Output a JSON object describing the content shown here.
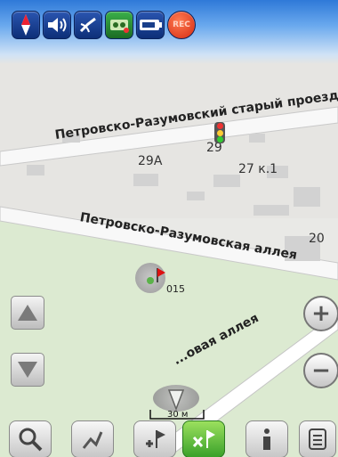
{
  "statusbar": {
    "icons": [
      "compass-icon",
      "speaker-icon",
      "satellite-icon",
      "tracker-icon",
      "battery-icon",
      "record-icon"
    ],
    "record_label": "REC"
  },
  "map": {
    "streets": {
      "top": "Петровско-Разумовский старый проезд",
      "middle": "Петровско-Разумовская аллея",
      "lower": "...овая аллея"
    },
    "houses": {
      "h29a": "29А",
      "h29": "29",
      "h27k1": "27 к.1",
      "h20": "20"
    },
    "poi": {
      "label": "015"
    },
    "scale": "30 м"
  },
  "controls": {
    "zoom_in": "+",
    "zoom_out": "−",
    "nav_up": "▲",
    "nav_down": "▼"
  },
  "toolbar": {
    "items": [
      {
        "icon": "search-icon"
      },
      {
        "icon": "route-icon"
      },
      {
        "icon": "add-waypoint-icon"
      },
      {
        "icon": "clear-route-icon"
      },
      {
        "icon": "info-icon"
      },
      {
        "icon": "menu-icon"
      }
    ]
  }
}
